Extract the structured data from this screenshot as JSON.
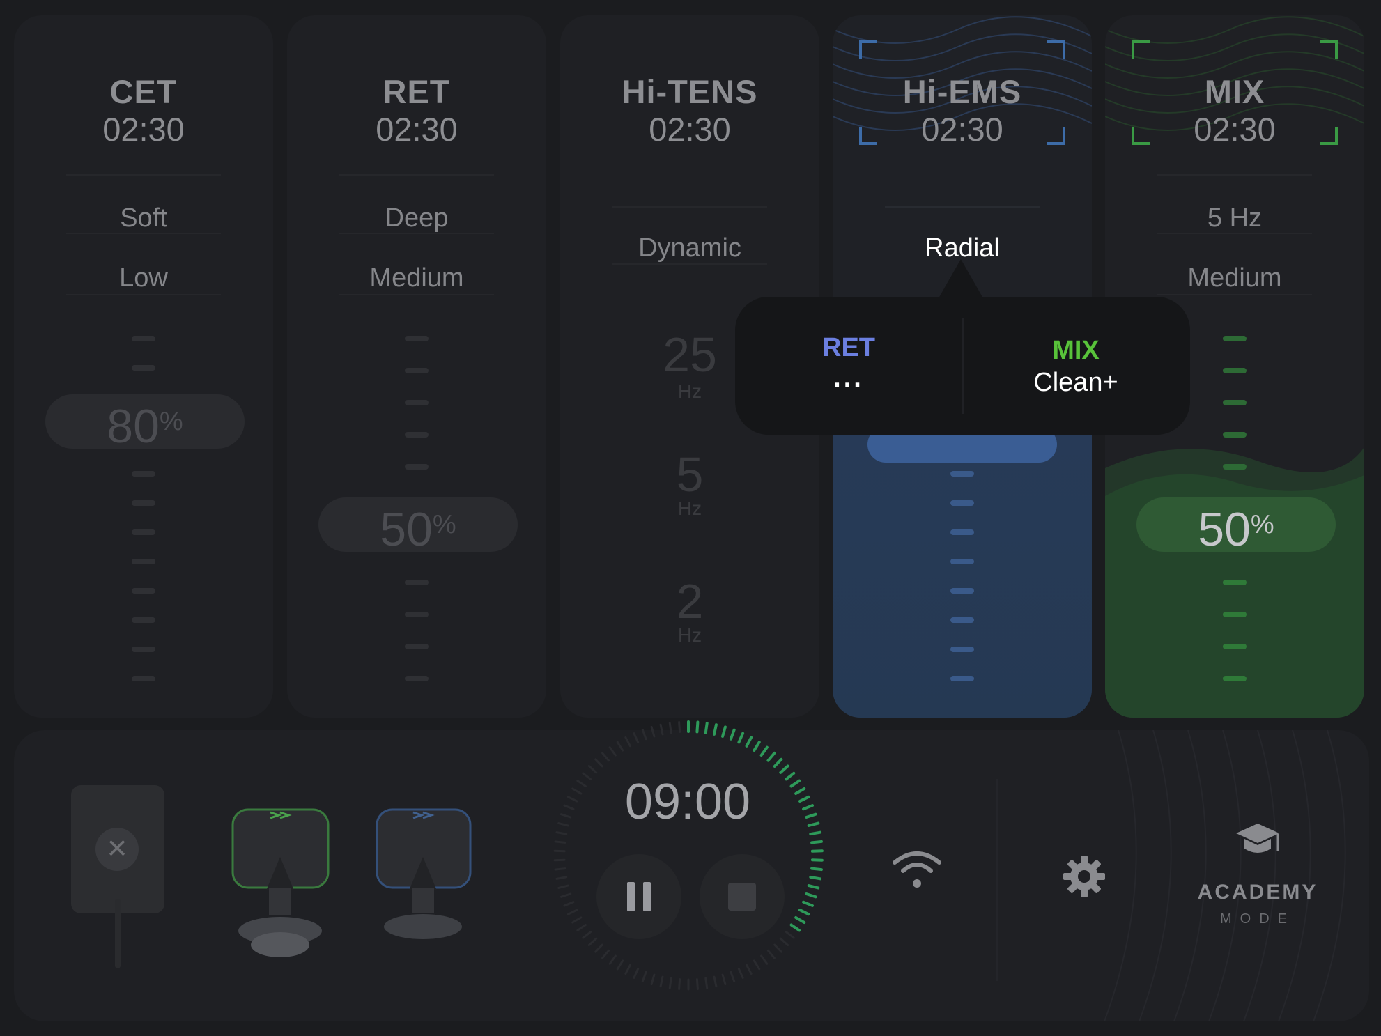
{
  "panels": [
    {
      "title": "CET",
      "time": "02:30",
      "option1": "Soft",
      "option2": "Low",
      "intensity": "80",
      "pct_symbol": "%"
    },
    {
      "title": "RET",
      "time": "02:30",
      "option1": "Deep",
      "option2": "Medium",
      "intensity": "50",
      "pct_symbol": "%"
    },
    {
      "title": "Hi-TENS",
      "time": "02:30",
      "option1": "Dynamic",
      "frequencies": [
        {
          "value": "25",
          "unit": "Hz"
        },
        {
          "value": "5",
          "unit": "Hz"
        },
        {
          "value": "2",
          "unit": "Hz"
        }
      ]
    },
    {
      "title": "Hi-EMS",
      "time": "02:30",
      "option1": "Radial",
      "accent": "#3d6ca8"
    },
    {
      "title": "MIX",
      "time": "02:30",
      "option1": "5 Hz",
      "option2": "Medium",
      "intensity": "50",
      "pct_symbol": "%",
      "accent": "#3a9a44"
    }
  ],
  "popup": {
    "left": {
      "mode": "RET",
      "sub": "...",
      "color": "#6b7fe0"
    },
    "right": {
      "mode": "MIX",
      "sub": "Clean+",
      "color": "#58c23a"
    }
  },
  "bottom": {
    "timer": "09:00",
    "timer_progress": 0.35,
    "academy_title": "ACADEMY",
    "academy_sub": "MODE",
    "icons": [
      "pad-remove-icon",
      "applicator-green-icon",
      "applicator-blue-icon",
      "pause-icon",
      "stop-icon",
      "wifi-icon",
      "gear-icon",
      "graduation-cap-icon"
    ]
  }
}
